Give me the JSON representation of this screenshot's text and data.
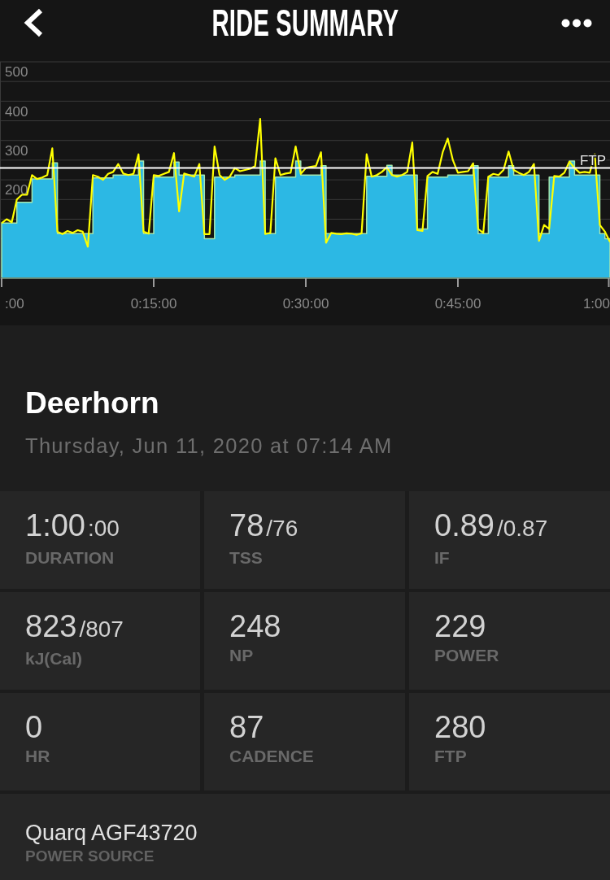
{
  "header": {
    "title": "RIDE SUMMARY"
  },
  "chart": {
    "chart_data": {
      "type": "area",
      "x": [
        0,
        0.5,
        1,
        1.5,
        2,
        2.5,
        3,
        3.5,
        4,
        4.5,
        5,
        5.5,
        6,
        6.5,
        7,
        7.5,
        8,
        8.5,
        9,
        9.5,
        10,
        10.5,
        11,
        11.5,
        12,
        12.5,
        13,
        13.5,
        14,
        14.5,
        15,
        15.5,
        16,
        16.5,
        17,
        17.5,
        18,
        18.5,
        19,
        19.5,
        20,
        20.5,
        21,
        21.5,
        22,
        22.5,
        23,
        23.5,
        24,
        24.5,
        25,
        25.5,
        26,
        26.5,
        27,
        27.5,
        28,
        28.5,
        29,
        29.5,
        30,
        30.5,
        31,
        31.5,
        32,
        32.5,
        33,
        33.5,
        34,
        34.5,
        35,
        35.5,
        36,
        36.5,
        37,
        37.5,
        38,
        38.5,
        39,
        39.5,
        40,
        40.5,
        41,
        41.5,
        42,
        42.5,
        43,
        43.5,
        44,
        44.5,
        45,
        45.5,
        46,
        46.5,
        47,
        47.5,
        48,
        48.5,
        49,
        49.5,
        50,
        50.5,
        51,
        51.5,
        52,
        52.5,
        53,
        53.5,
        54,
        54.5,
        55,
        55.5,
        56,
        56.5,
        57,
        57.5,
        58,
        58.5,
        59,
        59.5,
        60
      ],
      "series": [
        {
          "type": "area",
          "color": "#2cb8e4",
          "values": [
            140,
            140,
            140,
            193,
            193,
            193,
            252,
            252,
            252,
            252,
            293,
            113,
            113,
            113,
            113,
            113,
            113,
            113,
            255,
            255,
            255,
            255,
            262,
            262,
            262,
            262,
            262,
            298,
            113,
            113,
            257,
            257,
            257,
            257,
            295,
            262,
            262,
            262,
            262,
            262,
            100,
            100,
            257,
            257,
            257,
            257,
            262,
            262,
            262,
            262,
            262,
            298,
            113,
            113,
            257,
            257,
            257,
            257,
            298,
            262,
            262,
            262,
            262,
            286,
            113,
            113,
            113,
            113,
            113,
            113,
            113,
            113,
            259,
            259,
            259,
            259,
            287,
            262,
            262,
            262,
            262,
            262,
            125,
            125,
            257,
            257,
            257,
            257,
            262,
            262,
            262,
            262,
            262,
            286,
            113,
            113,
            257,
            257,
            257,
            257,
            286,
            262,
            262,
            262,
            262,
            262,
            113,
            113,
            257,
            257,
            257,
            257,
            298,
            262,
            262,
            262,
            262,
            262,
            113,
            100,
            87
          ]
        },
        {
          "type": "line",
          "color": "#ffff00",
          "values": [
            140,
            150,
            142,
            200,
            212,
            212,
            262,
            252,
            256,
            262,
            330,
            118,
            112,
            120,
            115,
            122,
            118,
            80,
            262,
            258,
            250,
            265,
            270,
            290,
            266,
            262,
            265,
            315,
            118,
            113,
            262,
            260,
            265,
            270,
            318,
            170,
            266,
            262,
            258,
            290,
            112,
            112,
            335,
            262,
            250,
            258,
            280,
            272,
            275,
            278,
            285,
            405,
            112,
            115,
            305,
            262,
            266,
            268,
            335,
            265,
            280,
            283,
            285,
            320,
            90,
            115,
            113,
            112,
            114,
            113,
            110,
            114,
            315,
            258,
            262,
            270,
            282,
            262,
            258,
            262,
            270,
            345,
            122,
            120,
            260,
            270,
            265,
            320,
            355,
            300,
            268,
            270,
            272,
            292,
            125,
            115,
            258,
            265,
            262,
            275,
            322,
            275,
            268,
            262,
            270,
            290,
            95,
            135,
            125,
            260,
            258,
            268,
            296,
            280,
            268,
            270,
            268,
            315,
            135,
            118,
            92
          ]
        }
      ],
      "xlim": [
        0,
        60
      ],
      "ylim": [
        0,
        550
      ],
      "xticks": [
        {
          "value": 0,
          "label": ":00"
        },
        {
          "value": 15,
          "label": "0:15:00"
        },
        {
          "value": 30,
          "label": "0:30:00"
        },
        {
          "value": 45,
          "label": "0:45:00"
        },
        {
          "value": 60,
          "label": "1:00"
        }
      ],
      "yticks": [
        200,
        300,
        400,
        500
      ],
      "grid": true,
      "ref_lines": [
        {
          "axis": "y",
          "value": 280,
          "label": "FTP"
        }
      ]
    }
  },
  "ride": {
    "name": "Deerhorn",
    "date": "Thursday, Jun 11, 2020 at 07:14 AM"
  },
  "stats": [
    {
      "value": "1:00",
      "secondary": ":00",
      "label": "DURATION"
    },
    {
      "value": "78",
      "secondary": "/76",
      "label": "TSS"
    },
    {
      "value": "0.89",
      "secondary": "/0.87",
      "label": "IF"
    },
    {
      "value": "823",
      "secondary": "/807",
      "label": "kJ(Cal)"
    },
    {
      "value": "248",
      "label": "NP"
    },
    {
      "value": "229",
      "label": "POWER"
    },
    {
      "value": "0",
      "label": "HR"
    },
    {
      "value": "87",
      "label": "CADENCE"
    },
    {
      "value": "280",
      "label": "FTP"
    }
  ],
  "power_source": {
    "value": "Quarq AGF43720",
    "label": "POWER SOURCE"
  }
}
